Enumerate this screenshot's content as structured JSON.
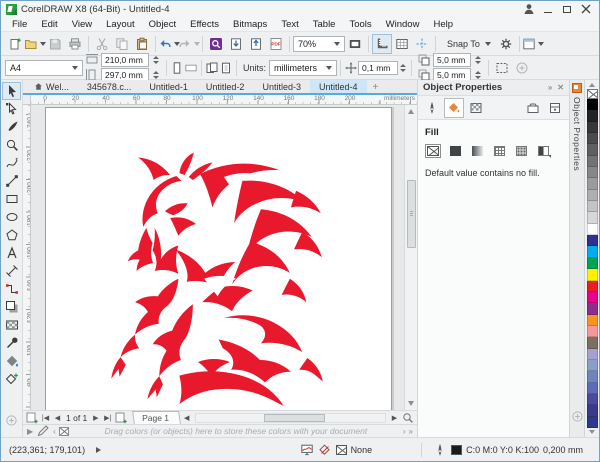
{
  "window": {
    "title": "CorelDRAW X8 (64-Bit) - Untitled-4"
  },
  "menu": {
    "items": [
      "File",
      "Edit",
      "View",
      "Layout",
      "Object",
      "Effects",
      "Bitmaps",
      "Text",
      "Table",
      "Tools",
      "Window",
      "Help"
    ]
  },
  "toolbar": {
    "zoom_level": "70%",
    "snap_label": "Snap To"
  },
  "property_bar": {
    "page_size": "A4",
    "page_width": "210,0 mm",
    "page_height": "297,0 mm",
    "units_label": "Units:",
    "units_value": "millimeters",
    "nudge_distance": "0,1 mm",
    "duplicate_x": "5,0 mm",
    "duplicate_y": "5,0 mm"
  },
  "document_tabs": {
    "tabs": [
      {
        "label": "Wel...",
        "home": true,
        "active": false
      },
      {
        "label": "345678.c...",
        "active": false
      },
      {
        "label": "Untitled-1",
        "active": false
      },
      {
        "label": "Untitled-2",
        "active": false
      },
      {
        "label": "Untitled-3",
        "active": false
      },
      {
        "label": "Untitled-4",
        "active": true
      }
    ],
    "new_tab": "+"
  },
  "rulers": {
    "horizontal_labels": [
      "0",
      "20",
      "40",
      "60",
      "80",
      "100",
      "120",
      "140",
      "160",
      "180",
      "200"
    ],
    "unit_caption": "millimeters",
    "vertical_labels": [
      "240",
      "220",
      "200",
      "180",
      "160",
      "140",
      "120",
      "100",
      "80"
    ]
  },
  "toolbox": {
    "active_tool": "pick-tool",
    "tools": [
      "pick-tool",
      "shape-tool",
      "crop-tool",
      "zoom-tool",
      "freehand-tool",
      "two-point-line-tool",
      "rectangle-tool",
      "ellipse-tool",
      "polygon-tool",
      "text-tool",
      "parallel-dimension-tool",
      "connector-tool",
      "drop-shadow-tool",
      "transparency-tool",
      "color-eyedropper-tool",
      "interactive-fill-tool",
      "smart-fill-tool"
    ]
  },
  "docker": {
    "title": "Object Properties",
    "side_tab": "Object Properties",
    "section": "Fill",
    "message": "Default value contains no fill."
  },
  "palette": {
    "colors": [
      "#000000",
      "#232323",
      "#373737",
      "#4b4b4b",
      "#5f5f5f",
      "#737373",
      "#878787",
      "#9b9b9b",
      "#afafaf",
      "#c3c3c3",
      "#d7d7d7",
      "#ffffff",
      "#2e3192",
      "#00adee",
      "#00a551",
      "#fff100",
      "#ec1c24",
      "#eb008b",
      "#8c2e8c",
      "#f7941e",
      "#f5989d",
      "#7d6e62",
      "#a79fd0",
      "#8d9dc9",
      "#6f83bf",
      "#5b6bb5",
      "#4a4a9f",
      "#3a3a8c",
      "#2b3990"
    ]
  },
  "page_controls": {
    "position": "1 of 1",
    "page_tab": "Page 1"
  },
  "document_palette": {
    "hint": "Drag colors (or objects) here to store these colors with your document"
  },
  "status_bar": {
    "cursor_position": "(223,361; 179,101)",
    "fill_value": "None",
    "outline_color": "C:0 M:0 Y:0 K:100",
    "outline_width": "0,200 mm"
  },
  "artwork": {
    "subject": "tribal flame horse clipart",
    "color": "#e8192c"
  }
}
